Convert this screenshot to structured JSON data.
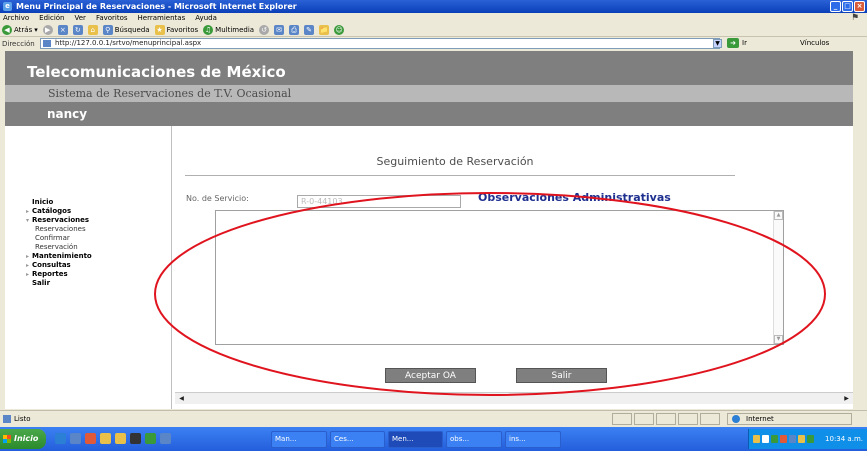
{
  "window": {
    "title": "Menu Principal de Reservaciones - Microsoft Internet Explorer",
    "buttons": [
      "_",
      "□",
      "×"
    ]
  },
  "menubar": {
    "items": [
      "Archivo",
      "Edición",
      "Ver",
      "Favoritos",
      "Herramientas",
      "Ayuda"
    ]
  },
  "toolbar": {
    "back": "Atrás",
    "search": "Búsqueda",
    "favorites": "Favoritos",
    "media": "Multimedia"
  },
  "address": {
    "label": "Dirección",
    "url": "http://127.0.0.1/srtvo/menuprincipal.aspx",
    "go": "Ir",
    "links": "Vínculos"
  },
  "page": {
    "title": "Telecomunicaciones de México",
    "subtitle": "Sistema de Reservaciones de T.V. Ocasional",
    "user": "nancy"
  },
  "sidebar": {
    "items": [
      {
        "label": "Inicio",
        "bold": true
      },
      {
        "label": "Catálogos",
        "bold": true
      },
      {
        "label": "Reservaciones",
        "bold": true
      },
      {
        "label": "Reservaciones",
        "bold": false
      },
      {
        "label": "Confirmar",
        "bold": false
      },
      {
        "label": "Reservación",
        "bold": false
      },
      {
        "label": "Mantenimiento",
        "bold": true
      },
      {
        "label": "Consultas",
        "bold": true
      },
      {
        "label": "Reportes",
        "bold": true
      },
      {
        "label": "Salir",
        "bold": true
      }
    ]
  },
  "main": {
    "heading": "Seguimiento de Reservación",
    "service_label": "No. de Servicio:",
    "service_value": "R-0-44103",
    "observations_label": "Observaciones Administrativas",
    "accept_button": "Aceptar OA",
    "exit_button": "Salir"
  },
  "status": {
    "text": "Listo",
    "zone": "Internet"
  },
  "taskbar": {
    "start": "Inicio",
    "tasks": [
      "Man...",
      "Ces...",
      "Men...",
      "obs...",
      "ins..."
    ],
    "clock": "10:34 a.m."
  },
  "colors": {
    "titlebar": "#0a3fb8",
    "header_gray": "#7f7f7f",
    "subheader_gray": "#b8b8b8",
    "observations_blue": "#1e2f8f",
    "annotation_red": "#e0141e"
  }
}
